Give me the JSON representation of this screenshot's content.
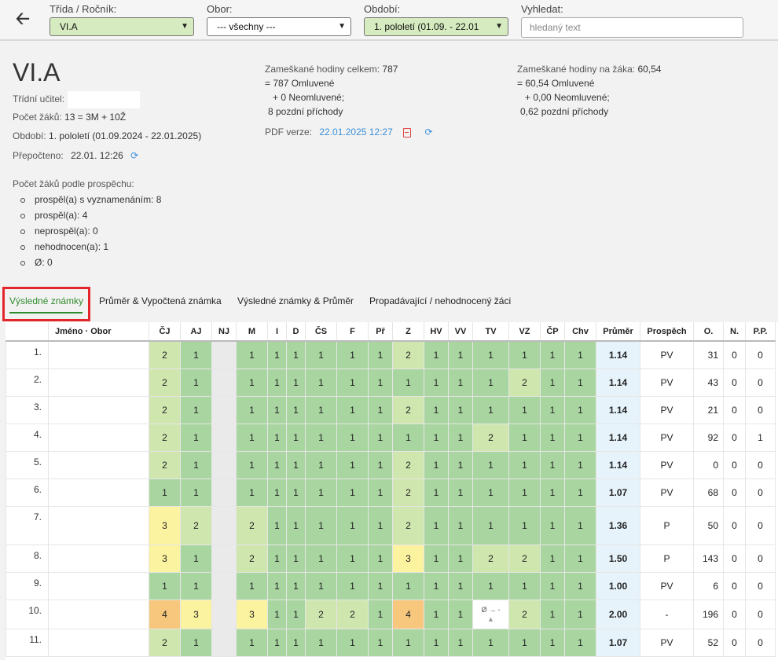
{
  "filters": {
    "trida_label": "Třída / Ročník:",
    "trida_value": "VI.A",
    "obor_label": "Obor:",
    "obor_value": "--- všechny ---",
    "obdobi_label": "Období:",
    "obdobi_value": "1. pololetí (01.09. - 22.01",
    "search_label": "Vyhledat:",
    "search_placeholder": "hledaný text"
  },
  "class_info": {
    "title": "VI.A",
    "teacher_label": "Třídní učitel:",
    "students_label": "Počet žáků:",
    "students_value": "13 = 3M + 10Ž",
    "period_label": "Období:",
    "period_value": "1. pololetí (01.09.2024 - 22.01.2025)",
    "recalc_label": "Přepočteno:",
    "recalc_value": "22.01. 12:26"
  },
  "absence_total": {
    "line1": "Zameškané hodiny celkem:",
    "line1_value": "787",
    "line2": "= 787 Omluvené",
    "line3": "+ 0 Neomluvené;",
    "line4": "8 pozdní příchody"
  },
  "absence_per_student": {
    "line1": "Zameškané hodiny na žáka:",
    "line1_value": "60,54",
    "line2": "= 60,54 Omluvené",
    "line3": "+ 0,00 Neomluvené;",
    "line4": "0,62 pozdní příchody"
  },
  "pdf": {
    "label": "PDF verze:",
    "value": "22.01.2025 12:27"
  },
  "prospech": {
    "heading": "Počet žáků podle prospěchu:",
    "items": [
      "prospěl(a) s vyznamenáním: 8",
      "prospěl(a): 4",
      "neprospěl(a): 0",
      "nehodnocen(a): 1",
      "Ø: 0"
    ]
  },
  "tabs": [
    "Výsledné známky",
    "Průměr & Vypočtená známka",
    "Výsledné známky & Průměr",
    "Propadávající / nehodnocený žáci"
  ],
  "table": {
    "headers": [
      "",
      "Jméno · Obor",
      "ČJ",
      "AJ",
      "NJ",
      "M",
      "I",
      "D",
      "ČS",
      "F",
      "Př",
      "Z",
      "HV",
      "VV",
      "TV",
      "VZ",
      "ČP",
      "Chv",
      "Průměr",
      "Prospěch",
      "O.",
      "N.",
      "P.P."
    ],
    "rows": [
      {
        "no": "1.",
        "grades": [
          "2",
          "1",
          "",
          "1",
          "1",
          "1",
          "1",
          "1",
          "1",
          "2",
          "1",
          "1",
          "1",
          "1",
          "1",
          "1"
        ],
        "avg": "1.14",
        "pros": "PV",
        "o": "31",
        "n": "0",
        "pp": "0"
      },
      {
        "no": "2.",
        "grades": [
          "2",
          "1",
          "",
          "1",
          "1",
          "1",
          "1",
          "1",
          "1",
          "1",
          "1",
          "1",
          "1",
          "2",
          "1",
          "1"
        ],
        "avg": "1.14",
        "pros": "PV",
        "o": "43",
        "n": "0",
        "pp": "0"
      },
      {
        "no": "3.",
        "grades": [
          "2",
          "1",
          "",
          "1",
          "1",
          "1",
          "1",
          "1",
          "1",
          "2",
          "1",
          "1",
          "1",
          "1",
          "1",
          "1"
        ],
        "avg": "1.14",
        "pros": "PV",
        "o": "21",
        "n": "0",
        "pp": "0"
      },
      {
        "no": "4.",
        "grades": [
          "2",
          "1",
          "",
          "1",
          "1",
          "1",
          "1",
          "1",
          "1",
          "1",
          "1",
          "1",
          "2",
          "1",
          "1",
          "1"
        ],
        "avg": "1.14",
        "pros": "PV",
        "o": "92",
        "n": "0",
        "pp": "1"
      },
      {
        "no": "5.",
        "grades": [
          "2",
          "1",
          "",
          "1",
          "1",
          "1",
          "1",
          "1",
          "1",
          "2",
          "1",
          "1",
          "1",
          "1",
          "1",
          "1"
        ],
        "avg": "1.14",
        "pros": "PV",
        "o": "0",
        "n": "0",
        "pp": "0"
      },
      {
        "no": "6.",
        "grades": [
          "1",
          "1",
          "",
          "1",
          "1",
          "1",
          "1",
          "1",
          "1",
          "2",
          "1",
          "1",
          "1",
          "1",
          "1",
          "1"
        ],
        "avg": "1.07",
        "pros": "PV",
        "o": "68",
        "n": "0",
        "pp": "0"
      },
      {
        "no": "7.",
        "grades": [
          "3",
          "2",
          "",
          "2",
          "1",
          "1",
          "1",
          "1",
          "1",
          "2",
          "1",
          "1",
          "1",
          "1",
          "1",
          "1"
        ],
        "avg": "1.36",
        "pros": "P",
        "o": "50",
        "n": "0",
        "pp": "0"
      },
      {
        "no": "8.",
        "grades": [
          "3",
          "1",
          "",
          "2",
          "1",
          "1",
          "1",
          "1",
          "1",
          "3",
          "1",
          "1",
          "2",
          "2",
          "1",
          "1"
        ],
        "avg": "1.50",
        "pros": "P",
        "o": "143",
        "n": "0",
        "pp": "0"
      },
      {
        "no": "9.",
        "grades": [
          "1",
          "1",
          "",
          "1",
          "1",
          "1",
          "1",
          "1",
          "1",
          "1",
          "1",
          "1",
          "1",
          "1",
          "1",
          "1"
        ],
        "avg": "1.00",
        "pros": "PV",
        "o": "6",
        "n": "0",
        "pp": "0"
      },
      {
        "no": "10.",
        "grades": [
          "4",
          "3",
          "",
          "3",
          "1",
          "1",
          "2",
          "2",
          "1",
          "4",
          "1",
          "1",
          "Ø → -",
          "2",
          "1",
          "1"
        ],
        "avg": "2.00",
        "pros": "-",
        "o": "196",
        "n": "0",
        "pp": "0"
      },
      {
        "no": "11.",
        "grades": [
          "2",
          "1",
          "",
          "1",
          "1",
          "1",
          "1",
          "1",
          "1",
          "1",
          "1",
          "1",
          "1",
          "1",
          "1",
          "1"
        ],
        "avg": "1.07",
        "pros": "PV",
        "o": "52",
        "n": "0",
        "pp": "0"
      }
    ]
  }
}
